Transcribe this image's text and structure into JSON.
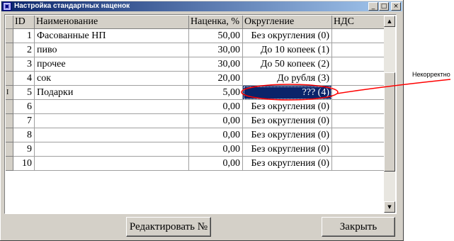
{
  "window": {
    "title": "Настройка стандартных наценок",
    "controls": {
      "minimize": "_",
      "maximize": "□",
      "close": "×"
    }
  },
  "grid": {
    "columns": [
      "ID",
      "Наименование",
      "Наценка, %",
      "Округление",
      "НДС"
    ],
    "rows": [
      {
        "id": "1",
        "name": "Фасованные НП",
        "markup": "50,00",
        "rounding": "Без округления (0)",
        "vat": ""
      },
      {
        "id": "2",
        "name": "пиво",
        "markup": "30,00",
        "rounding": "До 10 копеек (1)",
        "vat": ""
      },
      {
        "id": "3",
        "name": "прочее",
        "markup": "30,00",
        "rounding": "До 50 копеек (2)",
        "vat": ""
      },
      {
        "id": "4",
        "name": "сок",
        "markup": "20,00",
        "rounding": "До рубля (3)",
        "vat": ""
      },
      {
        "id": "5",
        "name": "Подарки",
        "markup": "5,00",
        "rounding": "??? (4)",
        "vat": "",
        "indicator": "I"
      },
      {
        "id": "6",
        "name": "",
        "markup": "0,00",
        "rounding": "Без округления (0)",
        "vat": ""
      },
      {
        "id": "7",
        "name": "",
        "markup": "0,00",
        "rounding": "Без округления (0)",
        "vat": ""
      },
      {
        "id": "8",
        "name": "",
        "markup": "0,00",
        "rounding": "Без округления (0)",
        "vat": ""
      },
      {
        "id": "9",
        "name": "",
        "markup": "0,00",
        "rounding": "Без округления (0)",
        "vat": ""
      },
      {
        "id": "10",
        "name": "",
        "markup": "0,00",
        "rounding": "Без округления (0)",
        "vat": ""
      }
    ],
    "selected_row_index": 4
  },
  "buttons": {
    "edit": "Редактировать №",
    "close": "Закрыть"
  },
  "annotation": {
    "label": "Некорректно",
    "color": "#ff0000"
  },
  "colors": {
    "title_start": "#0a246a",
    "title_end": "#a6caf0",
    "selection": "#0a246a"
  }
}
